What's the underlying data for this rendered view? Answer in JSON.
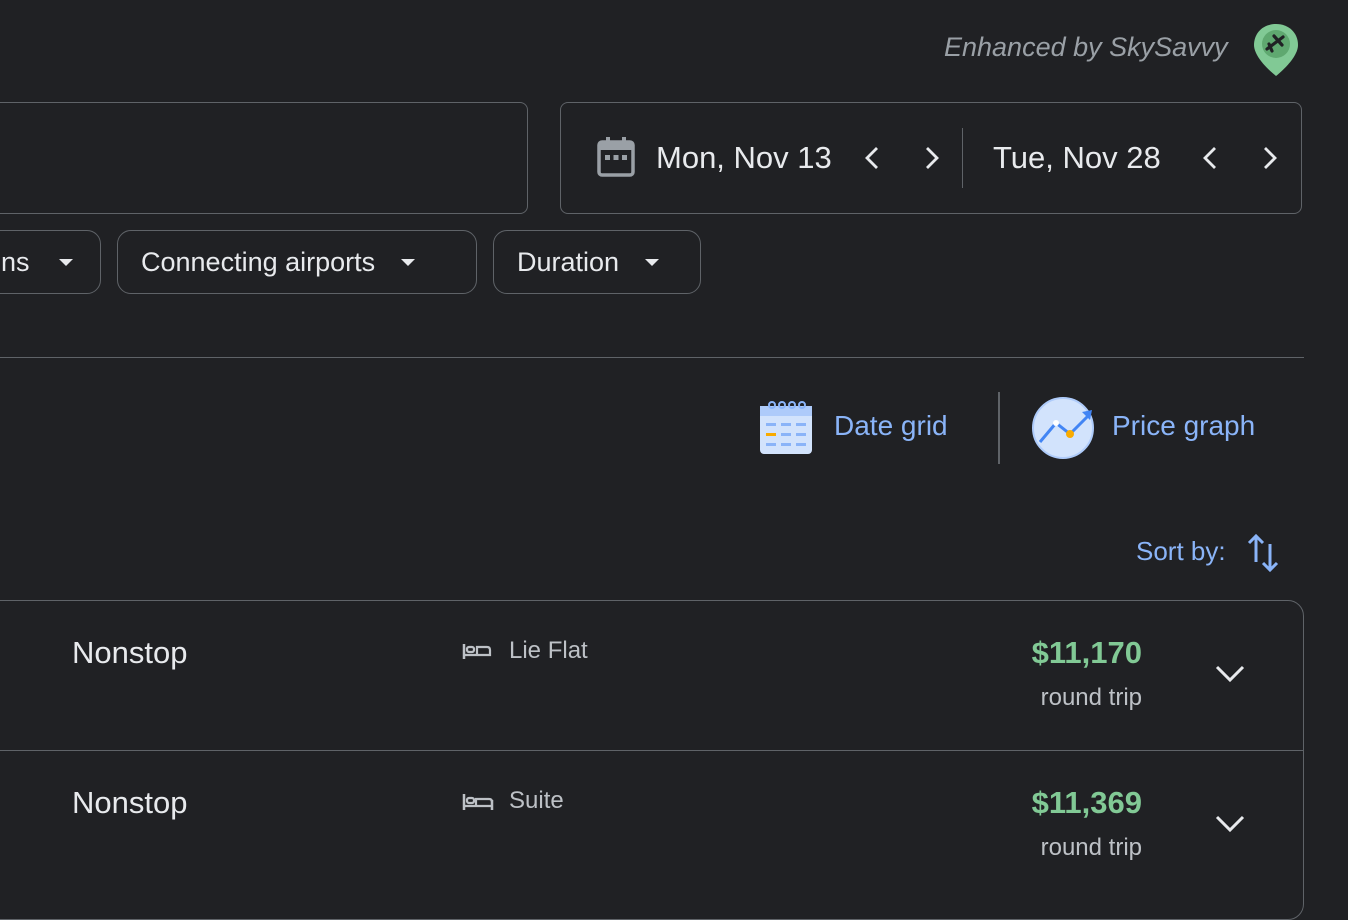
{
  "badge": {
    "text": "Enhanced by SkySavvy",
    "icon": "plane-pin-icon",
    "color": "#81c995"
  },
  "dates": {
    "icon": "calendar-icon",
    "departure": "Mon, Nov 13",
    "return": "Tue, Nov 28"
  },
  "filters": [
    {
      "label": "ons"
    },
    {
      "label": "Connecting airports"
    },
    {
      "label": "Duration"
    }
  ],
  "tools": {
    "date_grid": "Date grid",
    "price_graph": "Price graph"
  },
  "sort": {
    "label": "Sort by:"
  },
  "results": [
    {
      "stops": "Nonstop",
      "amenity": "Lie Flat",
      "amenity_icon": "lie-flat-seat-icon",
      "price": "$11,170",
      "price_note": "round trip"
    },
    {
      "stops": "Nonstop",
      "amenity": "Suite",
      "amenity_icon": "suite-bed-icon",
      "price": "$11,369",
      "price_note": "round trip"
    }
  ],
  "colors": {
    "accent": "#8ab4f8",
    "price": "#81c995",
    "background": "#202124",
    "border": "#5f6368"
  }
}
